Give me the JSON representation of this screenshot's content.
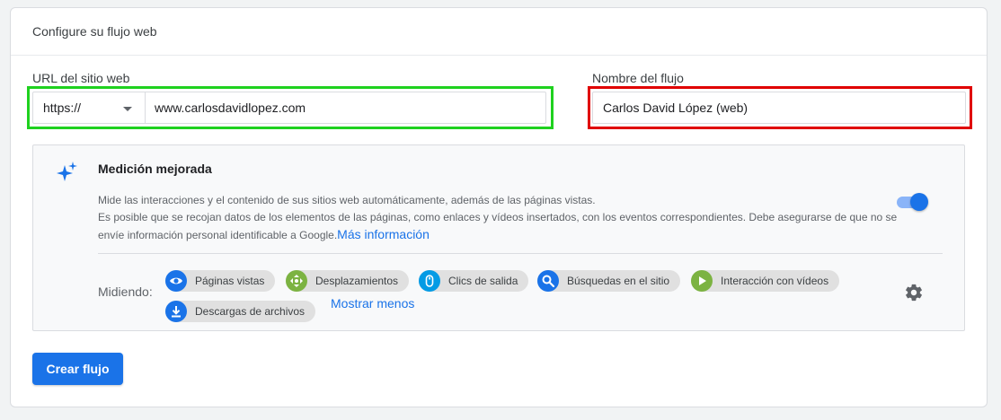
{
  "card": {
    "title": "Configure su flujo web"
  },
  "url_field": {
    "label": "URL del sitio web",
    "protocol": "https://",
    "value": "www.carlosdavidlopez.com"
  },
  "stream_name": {
    "label": "Nombre del flujo",
    "value": "Carlos David López (web)"
  },
  "enhanced": {
    "title": "Medición mejorada",
    "desc_line1": "Mide las interacciones y el contenido de sus sitios web automáticamente, además de las páginas vistas.",
    "desc_line2": "Es posible que se recojan datos de los elementos de las páginas, como enlaces y vídeos insertados, con los eventos correspondientes. Debe asegurarse de que no se envíe información personal identificable a Google.",
    "more_info": "Más información",
    "toggle_on": true,
    "measuring_label": "Midiendo:",
    "chips": [
      {
        "label": "Páginas vistas",
        "icon": "eye-icon",
        "color": "#1a73e8"
      },
      {
        "label": "Desplazamientos",
        "icon": "scroll-icon",
        "color": "#7cb342"
      },
      {
        "label": "Clics de salida",
        "icon": "mouse-icon",
        "color": "#039be5"
      },
      {
        "label": "Búsquedas en el sitio",
        "icon": "search-icon",
        "color": "#1a73e8"
      },
      {
        "label": "Interacción con vídeos",
        "icon": "play-icon",
        "color": "#7cb342"
      },
      {
        "label": "Descargas de archivos",
        "icon": "download-icon",
        "color": "#1a73e8"
      }
    ],
    "show_less": "Mostrar menos"
  },
  "create_button": "Crear flujo"
}
